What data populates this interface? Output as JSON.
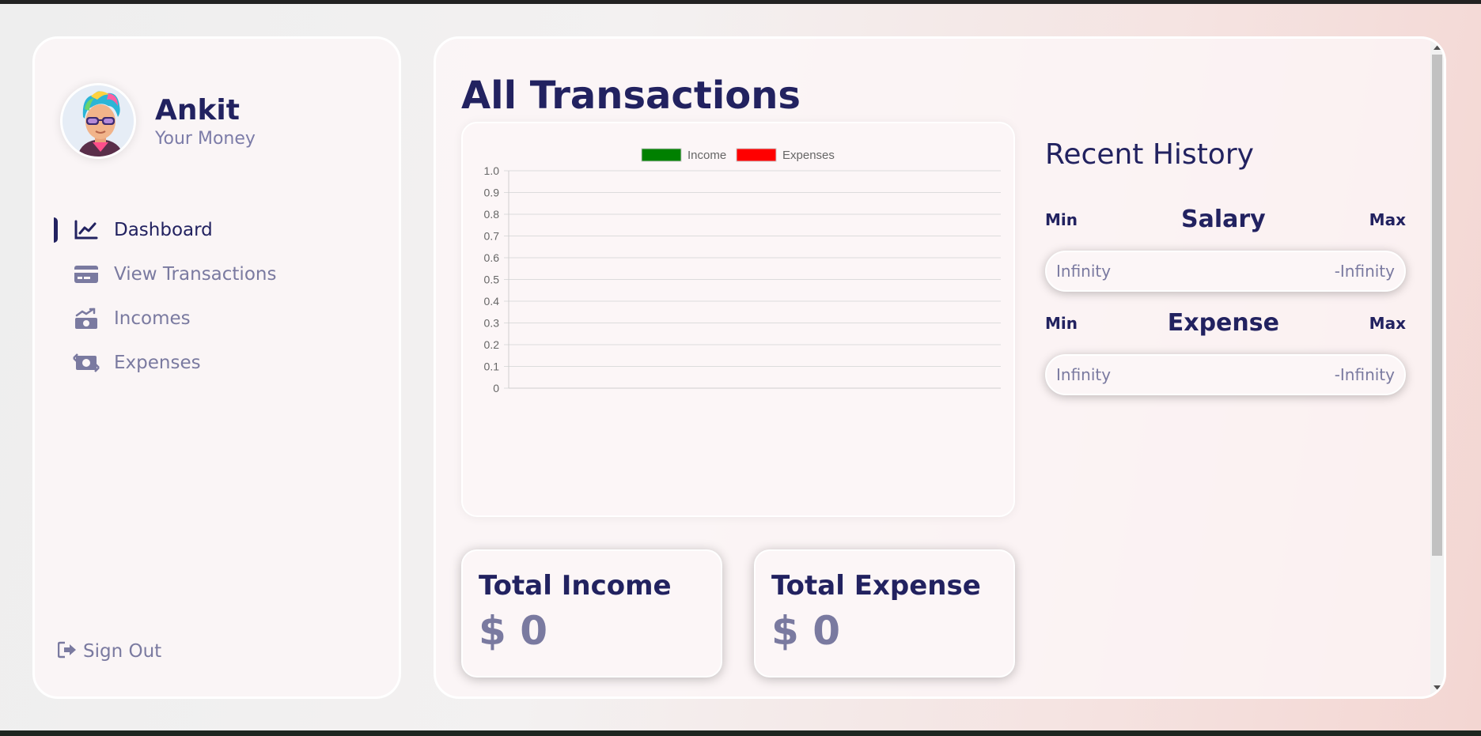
{
  "user": {
    "name": "Ankit",
    "subtitle": "Your Money"
  },
  "nav": [
    {
      "label": "Dashboard",
      "icon": "chart-line-icon",
      "active": true
    },
    {
      "label": "View Transactions",
      "icon": "credit-card-icon",
      "active": false
    },
    {
      "label": "Incomes",
      "icon": "money-bill-trend-up-icon",
      "active": false
    },
    {
      "label": "Expenses",
      "icon": "money-bill-transfer-icon",
      "active": false
    }
  ],
  "signout": {
    "label": "Sign Out",
    "icon": "sign-out-icon"
  },
  "page": {
    "title": "All Transactions"
  },
  "totals": {
    "income": {
      "title": "Total Income",
      "value": "$ 0"
    },
    "expense": {
      "title": "Total Expense",
      "value": "$ 0"
    }
  },
  "history": {
    "title": "Recent History",
    "salary": {
      "name": "Salary",
      "min_label": "Min",
      "max_label": "Max",
      "min_value": "Infinity",
      "max_value": "-Infinity"
    },
    "expense": {
      "name": "Expense",
      "min_label": "Min",
      "max_label": "Max",
      "min_value": "Infinity",
      "max_value": "-Infinity"
    }
  },
  "colors": {
    "accent": "#222260",
    "muted": "#7a7aa0",
    "income": "#008000",
    "expenses": "#ff0000"
  },
  "chart_data": {
    "type": "line",
    "legend_position": "top",
    "series": [
      {
        "name": "Income",
        "color": "#008000",
        "values": []
      },
      {
        "name": "Expenses",
        "color": "#ff0000",
        "values": []
      }
    ],
    "categories": [],
    "ylim": [
      0,
      1.0
    ],
    "y_ticks": [
      "1.0",
      "0.9",
      "0.8",
      "0.7",
      "0.6",
      "0.5",
      "0.4",
      "0.3",
      "0.2",
      "0.1",
      "0"
    ],
    "grid": true
  }
}
